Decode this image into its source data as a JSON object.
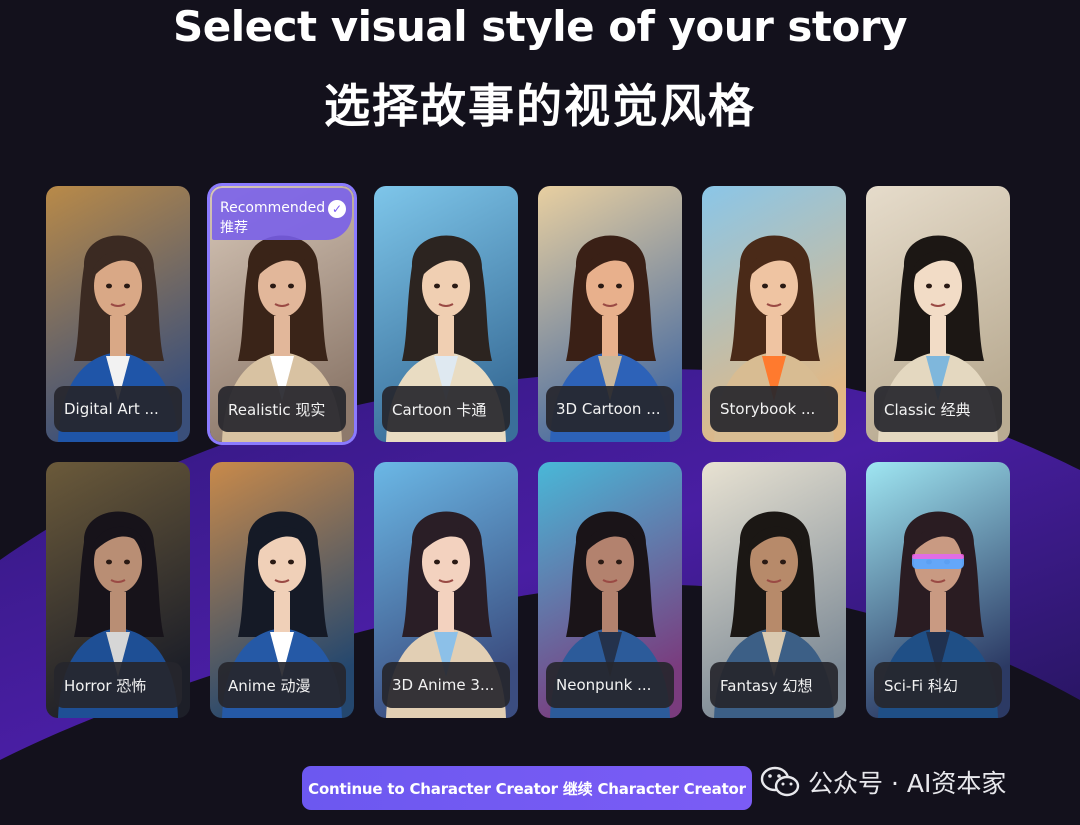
{
  "header": {
    "title_en": "Select visual style of your story",
    "title_zh": "选择故事的视觉风格"
  },
  "styles": [
    {
      "label": "Digital Art ...",
      "selected": false
    },
    {
      "label": "Realistic 现实",
      "selected": true,
      "badge": "Recommended 推荐"
    },
    {
      "label": "Cartoon 卡通",
      "selected": false
    },
    {
      "label": "3D Cartoon ...",
      "selected": false
    },
    {
      "label": "Storybook ...",
      "selected": false
    },
    {
      "label": "Classic 经典",
      "selected": false
    },
    {
      "label": "Horror 恐怖",
      "selected": false
    },
    {
      "label": "Anime 动漫",
      "selected": false
    },
    {
      "label": "3D Anime 3...",
      "selected": false
    },
    {
      "label": "Neonpunk ...",
      "selected": false
    },
    {
      "label": "Fantasy 幻想",
      "selected": false
    },
    {
      "label": "Sci-Fi 科幻",
      "selected": false
    }
  ],
  "footer": {
    "continue_label": "Continue to Character Creator 继续 Character Creator",
    "watermark": "公众号 · AI资本家"
  },
  "colors": {
    "background": "#13111c",
    "accent": "#7b5cf5",
    "wave": "#5a1fc8"
  }
}
